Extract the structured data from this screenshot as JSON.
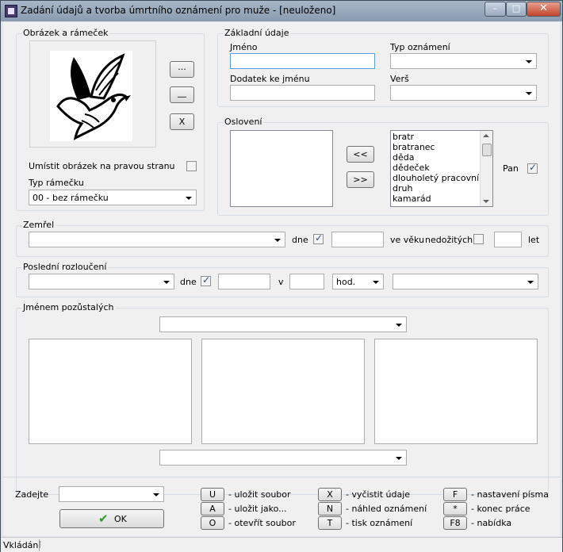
{
  "window": {
    "title": "Zadání údajů a tvorba úmrtního oznámení pro muže - [neuloženo]",
    "min_label": "–",
    "max_label": "□",
    "close_label": "✕"
  },
  "obrazek": {
    "title": "Obrázek a rámeček",
    "btn_browse": "...",
    "btn_dash": "__",
    "btn_x": "X",
    "right_side_label": "Umístit obrázek na pravou stranu",
    "frame_label": "Typ rámečku",
    "frame_value": "00 - bez rámečku"
  },
  "zakladni": {
    "title": "Základní údaje",
    "jmeno_label": "Jméno",
    "typ_label": "Typ oznámení",
    "dodatek_label": "Dodatek ke jménu",
    "vers_label": "Verš"
  },
  "osloveni": {
    "title": "Oslovení",
    "btn_left": "<<",
    "btn_right": ">>",
    "items": [
      "bratr",
      "bratranec",
      "děda",
      "dědeček",
      "dlouholetý pracovník",
      "druh",
      "kamarád"
    ],
    "pan_label": "Pan"
  },
  "zemrel": {
    "title": "Zemřel",
    "dne_label": "dne",
    "veku_label": "ve věku",
    "nedozitych_label": "nedožitých",
    "let_label": "let"
  },
  "rozlouceni": {
    "title": "Poslední rozloučení",
    "dne_label": "dne",
    "v_label": "v",
    "hod_value": "hod."
  },
  "pozustali": {
    "title": "Jménem pozůstalých"
  },
  "bottom": {
    "zadejte_label": "Zadejte",
    "ok_label": "OK",
    "shortcuts": [
      {
        "key": "U",
        "text": "- uložit soubor"
      },
      {
        "key": "A",
        "text": "- uložit jako..."
      },
      {
        "key": "O",
        "text": "- otevřít soubor"
      },
      {
        "key": "X",
        "text": "- vyčistit údaje"
      },
      {
        "key": "N",
        "text": "- náhled oznámení"
      },
      {
        "key": "T",
        "text": "- tisk oznámení"
      },
      {
        "key": "F",
        "text": "- nastavení písma"
      },
      {
        "key": "*",
        "text": "- konec práce"
      },
      {
        "key": "F8",
        "text": "- nabídka"
      }
    ]
  },
  "status": {
    "text": "Vkládání"
  }
}
